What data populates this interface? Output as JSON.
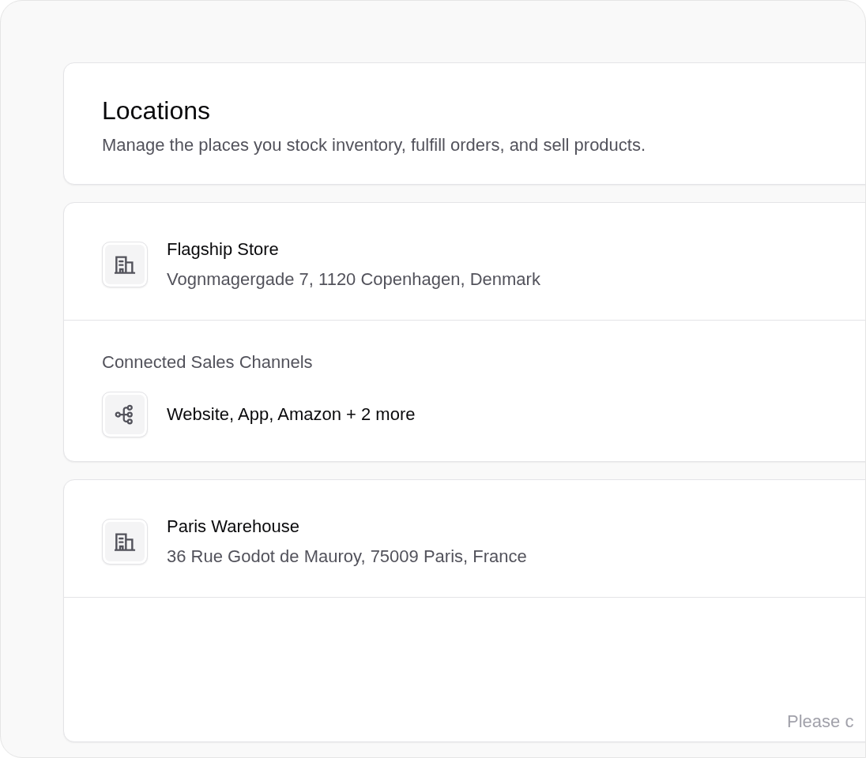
{
  "header": {
    "title": "Locations",
    "description": "Manage the places you stock inventory, fulfill orders, and sell products."
  },
  "locations": [
    {
      "name": "Flagship Store",
      "address": "Vognmagergade 7, 1120 Copenhagen, Denmark",
      "sales_channels": {
        "label": "Connected Sales Channels",
        "value": "Website, App, Amazon + 2 more"
      }
    },
    {
      "name": "Paris Warehouse",
      "address": "36 Rue Godot de Mauroy, 75009 Paris, France",
      "footer_note": "Please c"
    }
  ]
}
